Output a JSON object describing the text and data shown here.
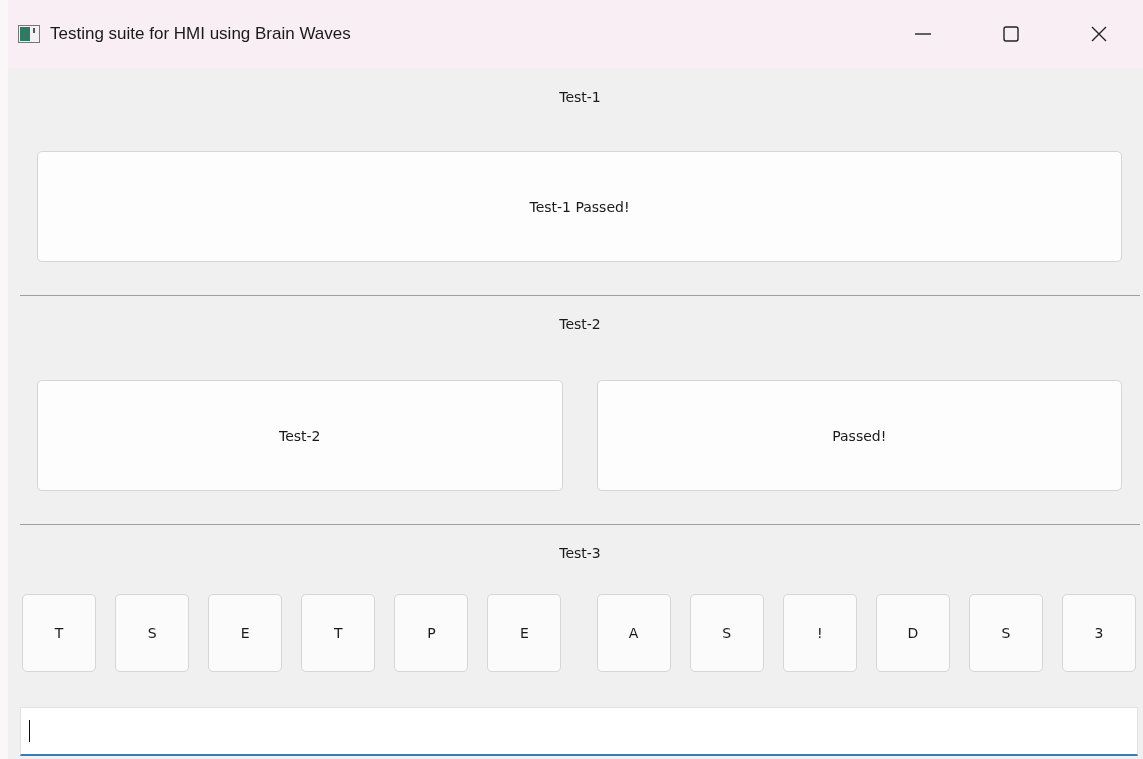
{
  "window": {
    "title": "Testing suite for HMI using Brain Waves"
  },
  "sections": [
    {
      "kind": "single",
      "label": "Test-1",
      "buttons": [
        "Test-1 Passed!"
      ]
    },
    {
      "kind": "pair",
      "label": "Test-2",
      "buttons": [
        "Test-2",
        "Passed!"
      ]
    },
    {
      "kind": "keys",
      "label": "Test-3",
      "key_groups": [
        [
          "T",
          "S",
          "E",
          "T",
          "P",
          "E"
        ],
        [
          "A",
          "S",
          "!",
          "D",
          "S",
          "3"
        ]
      ]
    }
  ],
  "input": {
    "focused": true
  }
}
